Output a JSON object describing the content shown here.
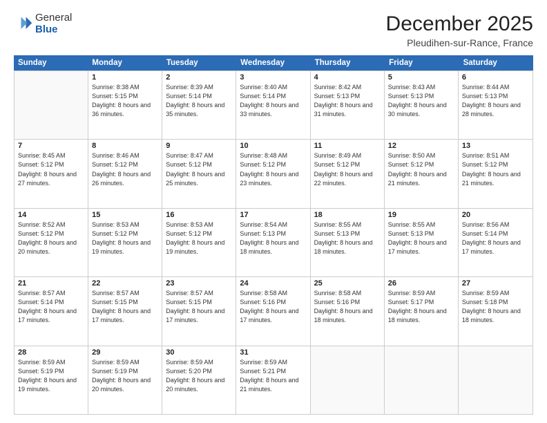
{
  "logo": {
    "general": "General",
    "blue": "Blue"
  },
  "title": "December 2025",
  "subtitle": "Pleudihen-sur-Rance, France",
  "header_days": [
    "Sunday",
    "Monday",
    "Tuesday",
    "Wednesday",
    "Thursday",
    "Friday",
    "Saturday"
  ],
  "weeks": [
    [
      {
        "day": "",
        "sunrise": "",
        "sunset": "",
        "daylight": ""
      },
      {
        "day": "1",
        "sunrise": "Sunrise: 8:38 AM",
        "sunset": "Sunset: 5:15 PM",
        "daylight": "Daylight: 8 hours and 36 minutes."
      },
      {
        "day": "2",
        "sunrise": "Sunrise: 8:39 AM",
        "sunset": "Sunset: 5:14 PM",
        "daylight": "Daylight: 8 hours and 35 minutes."
      },
      {
        "day": "3",
        "sunrise": "Sunrise: 8:40 AM",
        "sunset": "Sunset: 5:14 PM",
        "daylight": "Daylight: 8 hours and 33 minutes."
      },
      {
        "day": "4",
        "sunrise": "Sunrise: 8:42 AM",
        "sunset": "Sunset: 5:13 PM",
        "daylight": "Daylight: 8 hours and 31 minutes."
      },
      {
        "day": "5",
        "sunrise": "Sunrise: 8:43 AM",
        "sunset": "Sunset: 5:13 PM",
        "daylight": "Daylight: 8 hours and 30 minutes."
      },
      {
        "day": "6",
        "sunrise": "Sunrise: 8:44 AM",
        "sunset": "Sunset: 5:13 PM",
        "daylight": "Daylight: 8 hours and 28 minutes."
      }
    ],
    [
      {
        "day": "7",
        "sunrise": "Sunrise: 8:45 AM",
        "sunset": "Sunset: 5:12 PM",
        "daylight": "Daylight: 8 hours and 27 minutes."
      },
      {
        "day": "8",
        "sunrise": "Sunrise: 8:46 AM",
        "sunset": "Sunset: 5:12 PM",
        "daylight": "Daylight: 8 hours and 26 minutes."
      },
      {
        "day": "9",
        "sunrise": "Sunrise: 8:47 AM",
        "sunset": "Sunset: 5:12 PM",
        "daylight": "Daylight: 8 hours and 25 minutes."
      },
      {
        "day": "10",
        "sunrise": "Sunrise: 8:48 AM",
        "sunset": "Sunset: 5:12 PM",
        "daylight": "Daylight: 8 hours and 23 minutes."
      },
      {
        "day": "11",
        "sunrise": "Sunrise: 8:49 AM",
        "sunset": "Sunset: 5:12 PM",
        "daylight": "Daylight: 8 hours and 22 minutes."
      },
      {
        "day": "12",
        "sunrise": "Sunrise: 8:50 AM",
        "sunset": "Sunset: 5:12 PM",
        "daylight": "Daylight: 8 hours and 21 minutes."
      },
      {
        "day": "13",
        "sunrise": "Sunrise: 8:51 AM",
        "sunset": "Sunset: 5:12 PM",
        "daylight": "Daylight: 8 hours and 21 minutes."
      }
    ],
    [
      {
        "day": "14",
        "sunrise": "Sunrise: 8:52 AM",
        "sunset": "Sunset: 5:12 PM",
        "daylight": "Daylight: 8 hours and 20 minutes."
      },
      {
        "day": "15",
        "sunrise": "Sunrise: 8:53 AM",
        "sunset": "Sunset: 5:12 PM",
        "daylight": "Daylight: 8 hours and 19 minutes."
      },
      {
        "day": "16",
        "sunrise": "Sunrise: 8:53 AM",
        "sunset": "Sunset: 5:12 PM",
        "daylight": "Daylight: 8 hours and 19 minutes."
      },
      {
        "day": "17",
        "sunrise": "Sunrise: 8:54 AM",
        "sunset": "Sunset: 5:13 PM",
        "daylight": "Daylight: 8 hours and 18 minutes."
      },
      {
        "day": "18",
        "sunrise": "Sunrise: 8:55 AM",
        "sunset": "Sunset: 5:13 PM",
        "daylight": "Daylight: 8 hours and 18 minutes."
      },
      {
        "day": "19",
        "sunrise": "Sunrise: 8:55 AM",
        "sunset": "Sunset: 5:13 PM",
        "daylight": "Daylight: 8 hours and 17 minutes."
      },
      {
        "day": "20",
        "sunrise": "Sunrise: 8:56 AM",
        "sunset": "Sunset: 5:14 PM",
        "daylight": "Daylight: 8 hours and 17 minutes."
      }
    ],
    [
      {
        "day": "21",
        "sunrise": "Sunrise: 8:57 AM",
        "sunset": "Sunset: 5:14 PM",
        "daylight": "Daylight: 8 hours and 17 minutes."
      },
      {
        "day": "22",
        "sunrise": "Sunrise: 8:57 AM",
        "sunset": "Sunset: 5:15 PM",
        "daylight": "Daylight: 8 hours and 17 minutes."
      },
      {
        "day": "23",
        "sunrise": "Sunrise: 8:57 AM",
        "sunset": "Sunset: 5:15 PM",
        "daylight": "Daylight: 8 hours and 17 minutes."
      },
      {
        "day": "24",
        "sunrise": "Sunrise: 8:58 AM",
        "sunset": "Sunset: 5:16 PM",
        "daylight": "Daylight: 8 hours and 17 minutes."
      },
      {
        "day": "25",
        "sunrise": "Sunrise: 8:58 AM",
        "sunset": "Sunset: 5:16 PM",
        "daylight": "Daylight: 8 hours and 18 minutes."
      },
      {
        "day": "26",
        "sunrise": "Sunrise: 8:59 AM",
        "sunset": "Sunset: 5:17 PM",
        "daylight": "Daylight: 8 hours and 18 minutes."
      },
      {
        "day": "27",
        "sunrise": "Sunrise: 8:59 AM",
        "sunset": "Sunset: 5:18 PM",
        "daylight": "Daylight: 8 hours and 18 minutes."
      }
    ],
    [
      {
        "day": "28",
        "sunrise": "Sunrise: 8:59 AM",
        "sunset": "Sunset: 5:19 PM",
        "daylight": "Daylight: 8 hours and 19 minutes."
      },
      {
        "day": "29",
        "sunrise": "Sunrise: 8:59 AM",
        "sunset": "Sunset: 5:19 PM",
        "daylight": "Daylight: 8 hours and 20 minutes."
      },
      {
        "day": "30",
        "sunrise": "Sunrise: 8:59 AM",
        "sunset": "Sunset: 5:20 PM",
        "daylight": "Daylight: 8 hours and 20 minutes."
      },
      {
        "day": "31",
        "sunrise": "Sunrise: 8:59 AM",
        "sunset": "Sunset: 5:21 PM",
        "daylight": "Daylight: 8 hours and 21 minutes."
      },
      {
        "day": "",
        "sunrise": "",
        "sunset": "",
        "daylight": ""
      },
      {
        "day": "",
        "sunrise": "",
        "sunset": "",
        "daylight": ""
      },
      {
        "day": "",
        "sunrise": "",
        "sunset": "",
        "daylight": ""
      }
    ]
  ]
}
